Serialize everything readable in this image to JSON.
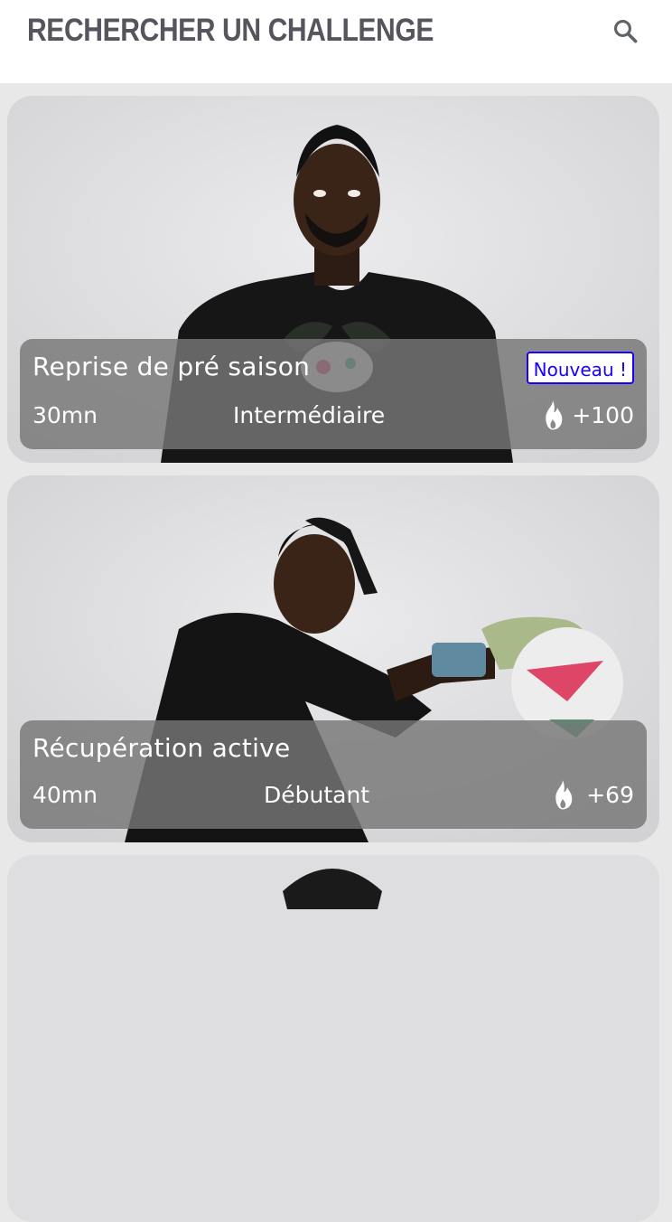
{
  "header": {
    "title": "RECHERCHER UN CHALLENGE",
    "search_icon": "search-icon"
  },
  "colors": {
    "badge_accent": "#1a00ff",
    "title_gray": "#55555e"
  },
  "challenges": [
    {
      "title": "Reprise de pré saison",
      "badge": "Nouveau !",
      "duration": "30mn",
      "level": "Intermédiaire",
      "points": "+100",
      "points_icon": "flame-icon"
    },
    {
      "title": "Récupération active",
      "duration": "40mn",
      "level": "Débutant",
      "points": "+69",
      "points_icon": "flame-icon"
    }
  ]
}
